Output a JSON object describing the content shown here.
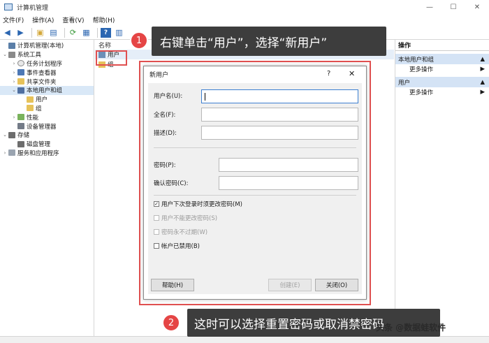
{
  "window": {
    "title": "计算机管理",
    "controls": [
      "—",
      "☐",
      "✕"
    ]
  },
  "menu": [
    "文件(F)",
    "操作(A)",
    "查看(V)",
    "帮助(H)"
  ],
  "toolbar": [
    "back-icon",
    "forward-icon",
    "folder-up-icon",
    "show-hide-tree-icon",
    "refresh-icon",
    "export-icon",
    "help-icon",
    "properties-icon"
  ],
  "tree": [
    {
      "label": "计算机管理(本地)",
      "indent": 0,
      "arrow": "",
      "icon": "computer"
    },
    {
      "label": "系统工具",
      "indent": 0,
      "arrow": "⌄",
      "icon": "tools"
    },
    {
      "label": "任务计划程序",
      "indent": 1,
      "arrow": "›",
      "icon": "clock"
    },
    {
      "label": "事件查看器",
      "indent": 1,
      "arrow": "›",
      "icon": "event"
    },
    {
      "label": "共享文件夹",
      "indent": 1,
      "arrow": "›",
      "icon": "folder"
    },
    {
      "label": "本地用户和组",
      "indent": 1,
      "arrow": "⌄",
      "icon": "users",
      "selected": true
    },
    {
      "label": "用户",
      "indent": 2,
      "arrow": "",
      "icon": "folder"
    },
    {
      "label": "组",
      "indent": 2,
      "arrow": "",
      "icon": "folder"
    },
    {
      "label": "性能",
      "indent": 1,
      "arrow": "›",
      "icon": "perf"
    },
    {
      "label": "设备管理器",
      "indent": 1,
      "arrow": "",
      "icon": "device"
    },
    {
      "label": "存储",
      "indent": 0,
      "arrow": "⌄",
      "icon": "disk"
    },
    {
      "label": "磁盘管理",
      "indent": 1,
      "arrow": "",
      "icon": "disk"
    },
    {
      "label": "服务和应用程序",
      "indent": 0,
      "arrow": "›",
      "icon": "service"
    }
  ],
  "list": {
    "header": "名称",
    "rows": [
      "用户",
      "组"
    ]
  },
  "actions": {
    "title": "操作",
    "sections": [
      {
        "title": "本地用户和组",
        "items": [
          "更多操作"
        ]
      },
      {
        "title": "用户",
        "items": [
          "更多操作"
        ]
      }
    ]
  },
  "callout1": {
    "badge": "1",
    "text": "右键单击“用户”，选择“新用户”"
  },
  "callout2": {
    "badge": "2",
    "text": "这时可以选择重置密码或取消禁密码"
  },
  "dialog": {
    "title": "新用户",
    "help_glyph": "?",
    "close_glyph": "✕",
    "fields": {
      "username_label": "用户名(U):",
      "username_value": "",
      "fullname_label": "全名(F):",
      "fullname_value": "",
      "description_label": "描述(D):",
      "description_value": "",
      "password_label": "密码(P):",
      "password_value": "",
      "confirm_label": "确认密码(C):",
      "confirm_value": ""
    },
    "checks": [
      {
        "label": "用户下次登录时须更改密码(M)",
        "checked": true,
        "disabled": false
      },
      {
        "label": "用户不能更改密码(S)",
        "checked": false,
        "disabled": true
      },
      {
        "label": "密码永不过期(W)",
        "checked": false,
        "disabled": true
      },
      {
        "label": "帐户已禁用(B)",
        "checked": false,
        "disabled": false
      }
    ],
    "buttons": {
      "help": "帮助(H)",
      "create": "创建(E)",
      "close": "关闭(O)"
    }
  },
  "watermark": "头条 @数据蛙软件"
}
